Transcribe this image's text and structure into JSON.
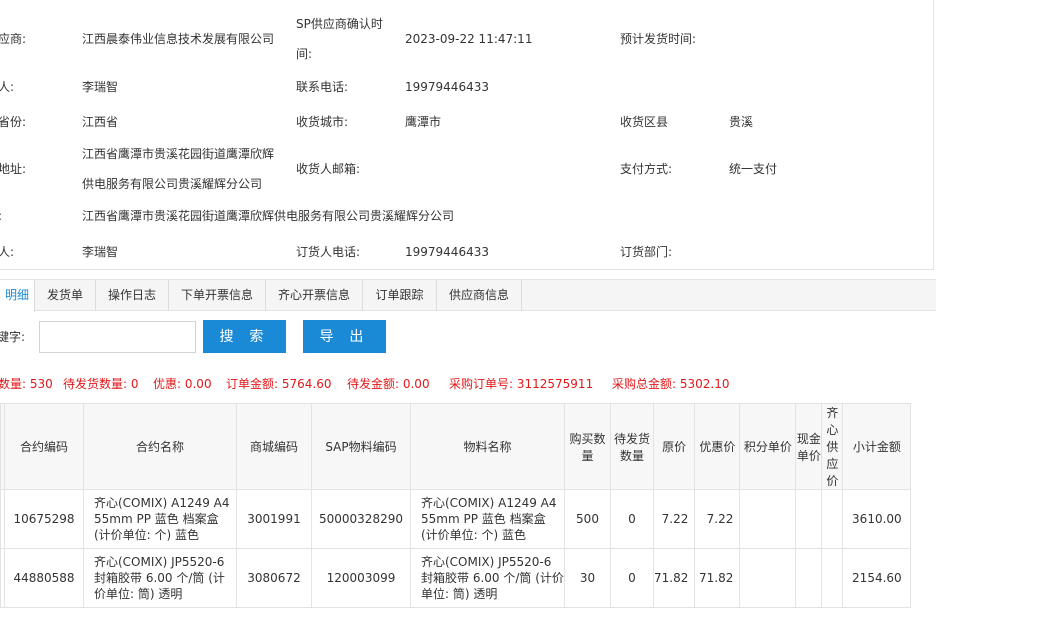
{
  "info": {
    "row1": {
      "label": "应商:",
      "value": "江西晨泰伟业信息技术发展有限公司",
      "label2_line1": "SP供应商确认时",
      "label2_line2": "间:",
      "value2": "2023-09-22 11:47:11",
      "label3": "预计发货时间:",
      "value3": ""
    },
    "row2": {
      "label": "人:",
      "value": "李瑞智",
      "label2": "联系电话:",
      "value2": "19979446433"
    },
    "row3": {
      "label": "省份:",
      "value": "江西省",
      "label2": "收货城市:",
      "value2": "鹰潭市",
      "label3": "收货区县",
      "value3": "贵溪"
    },
    "row4": {
      "label": "地址:",
      "value_line1": "江西省鹰潭市贵溪花园街道鹰潭欣辉",
      "value_line2": "供电服务有限公司贵溪耀辉分公司",
      "label2": "收货人邮箱:",
      "value2": "",
      "label3": "支付方式:",
      "value3": "统一支付"
    },
    "row5": {
      "label": ":",
      "value": "江西省鹰潭市贵溪花园街道鹰潭欣辉供电服务有限公司贵溪耀辉分公司"
    },
    "row6": {
      "label": "人:",
      "value": "李瑞智",
      "label2": "订货人电话:",
      "value2": "19979446433",
      "label3": "订货部门:",
      "value3": ""
    }
  },
  "tabs": [
    "明细",
    "发货单",
    "操作日志",
    "下单开票信息",
    "齐心开票信息",
    "订单跟踪",
    "供应商信息"
  ],
  "search": {
    "label": "键字:",
    "value": "",
    "search_button": "搜 索",
    "export_button": "导 出"
  },
  "summary": {
    "s1": "数量: 530",
    "s2": "待发货数量: 0",
    "s3": "优惠: 0.00",
    "s4": "订单金额: 5764.60",
    "s5": "待发金额: 0.00",
    "s6": "采购订单号: 3112575911",
    "s7": "采购总金额: 5302.10"
  },
  "table": {
    "headers": [
      "合约编码",
      "合约名称",
      "商城编码",
      "SAP物料编码",
      "物料名称",
      "购买数量",
      "待发货数量",
      "原价",
      "优惠价",
      "积分单价",
      "现金单价",
      "齐心供应价",
      "小计金额"
    ],
    "rows": [
      [
        "10675298",
        "齐心(COMIX) A1249 A4 55mm PP 蓝色 档案盒 (计价单位: 个) 蓝色",
        "3001991",
        "50000328290",
        "齐心(COMIX) A1249 A4 55mm PP 蓝色 档案盒 (计价单位: 个) 蓝色",
        "500",
        "0",
        "7.22",
        "7.22",
        "",
        "",
        "",
        "3610.00"
      ],
      [
        "44880588",
        "齐心(COMIX) JP5520-6 封箱胶带 6.00 个/筒 (计价单位: 筒) 透明",
        "3080672",
        "120003099",
        "齐心(COMIX) JP5520-6 封箱胶带 6.00 个/筒 (计价单位: 筒) 透明",
        "30",
        "0",
        "71.82",
        "71.82",
        "",
        "",
        "",
        "2154.60"
      ]
    ]
  }
}
